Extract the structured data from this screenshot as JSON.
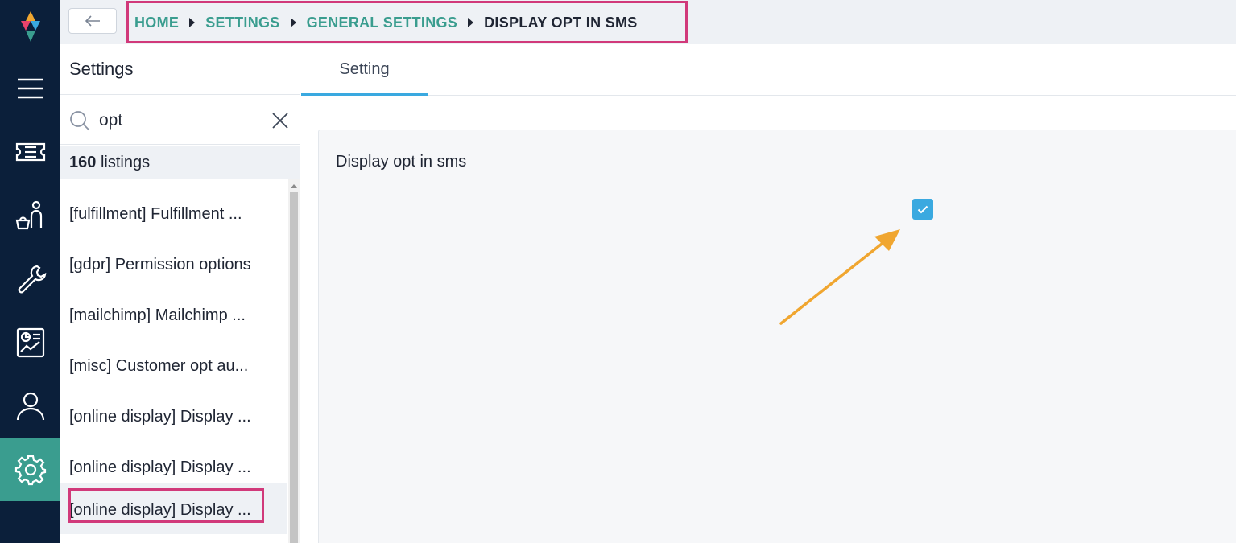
{
  "breadcrumb": {
    "items": [
      "HOME",
      "SETTINGS",
      "GENERAL SETTINGS"
    ],
    "current": "DISPLAY OPT IN SMS"
  },
  "sidebar": {
    "title": "Settings",
    "search": {
      "value": "opt"
    },
    "count_number": "160",
    "count_label": "listings",
    "items": [
      {
        "label": "[fulfillment] Fulfillment ..."
      },
      {
        "label": "[gdpr] Permission options"
      },
      {
        "label": "[mailchimp] Mailchimp ..."
      },
      {
        "label": "[misc] Customer opt au..."
      },
      {
        "label": "[online display] Display ..."
      },
      {
        "label": "[online display] Display ..."
      },
      {
        "label": "[online display] Display ..."
      }
    ]
  },
  "main": {
    "tabs": [
      {
        "label": "Setting"
      }
    ],
    "setting_title": "Display opt in sms",
    "checkbox_checked": true
  },
  "rail": {
    "icons": [
      "menu-icon",
      "ticket-icon",
      "customer-service-icon",
      "wrench-icon",
      "report-icon",
      "user-icon",
      "gear-icon"
    ],
    "active": "gear-icon"
  },
  "colors": {
    "rail_bg": "#0b1f3a",
    "accent_teal": "#3a9d8f",
    "accent_blue": "#3aa9e0",
    "highlight_pink": "#d1397a",
    "arrow_orange": "#f0a630"
  }
}
